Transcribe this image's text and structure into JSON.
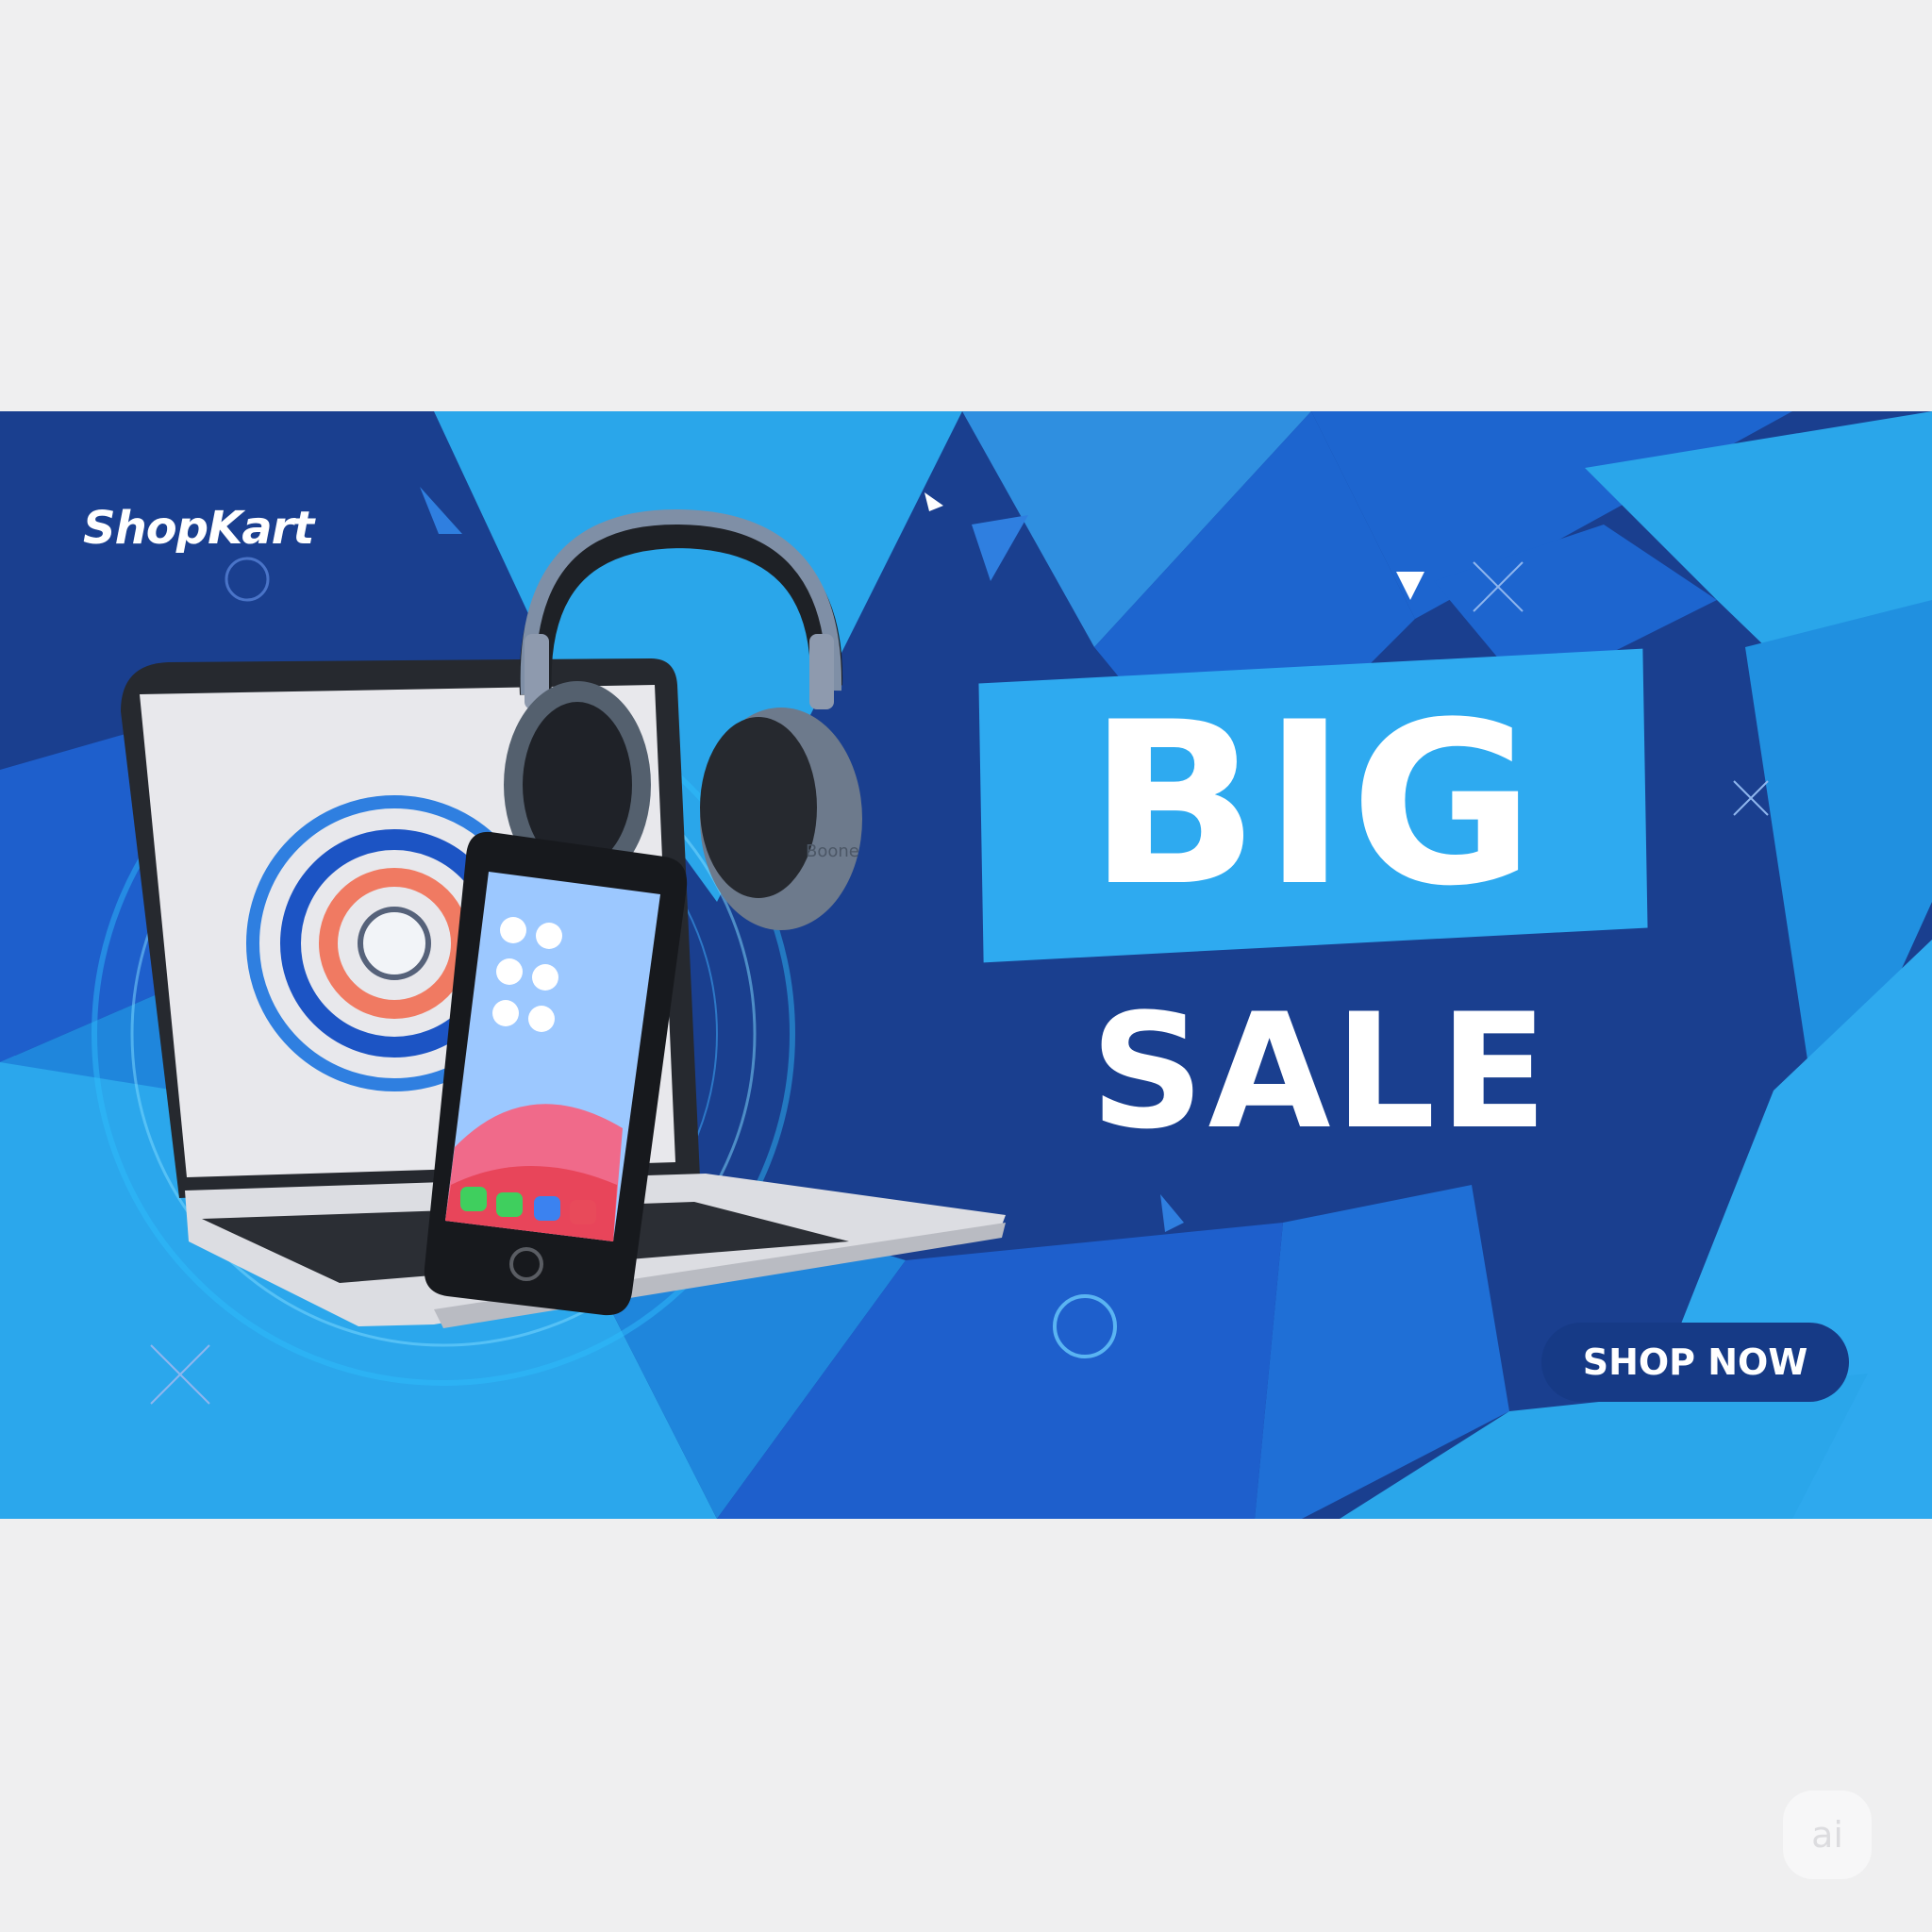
{
  "banner": {
    "brand": "ShopKart",
    "headline": "BIG",
    "subline": "SALE",
    "cta_label": "SHOP NOW",
    "headphone_brand_text": "Boone",
    "colors": {
      "deep_blue": "#1a3f8f",
      "mid_blue": "#1f6fd6",
      "light_blue": "#2eaaf0",
      "button": "#163a86",
      "text": "#ffffff"
    }
  },
  "products": [
    {
      "name": "laptop-icon"
    },
    {
      "name": "headphones-icon"
    },
    {
      "name": "smartphone-icon"
    }
  ],
  "watermark": {
    "label": "ai"
  }
}
